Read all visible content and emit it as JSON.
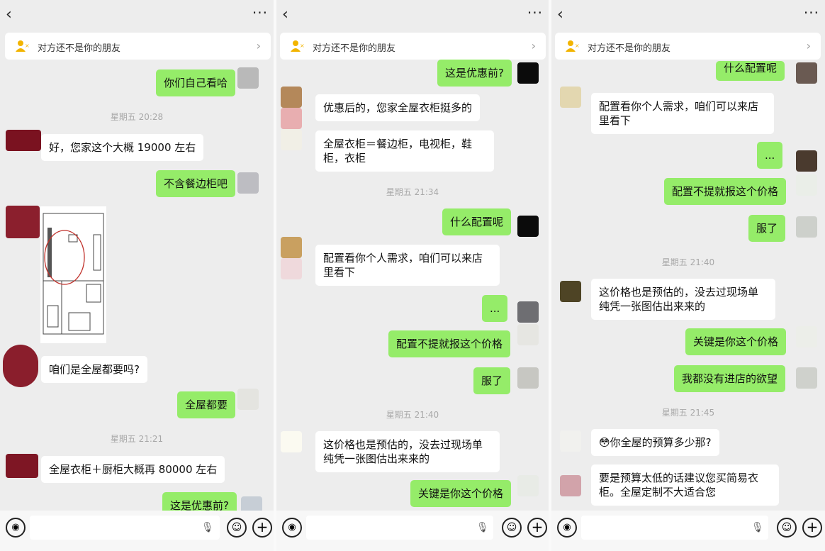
{
  "header": {
    "back_icon": "‹",
    "more_icon": "···"
  },
  "banner": {
    "text": "对方还不是你的朋友",
    "chevron": "›"
  },
  "input": {
    "voice_icon": "◉",
    "mic_icon": "🎙",
    "emoji_icon": "☺",
    "plus_icon": "+"
  },
  "panel1": {
    "m1": "你们自己看哈",
    "t1": "星期五 20:28",
    "m2": "好，您家这个大概 19000 左右",
    "m3": "不含餐边柜吧",
    "m4": "咱们是全屋都要吗?",
    "m5": "全屋都要",
    "t2": "星期五 21:21",
    "m6": "全屋衣柜＋厨柜大概再 80000 左右",
    "m7": "这是优惠前?"
  },
  "panel2": {
    "m1": "这是优惠前?",
    "m2": "优惠后的，您家全屋衣柜挺多的",
    "m3": "全屋衣柜＝餐边柜，电视柜，鞋柜，衣柜",
    "t1": "星期五 21:34",
    "m4": "什么配置呢",
    "m5": "配置看你个人需求，咱们可以来店里看下",
    "m6": "...",
    "m7": "配置不提就报这个价格",
    "m8": "服了",
    "t2": "星期五 21:40",
    "m9": "这价格也是预估的，没去过现场单纯凭一张图估出来来的",
    "m10": "关键是你这个价格"
  },
  "panel3": {
    "m1": "什么配置呢",
    "m2": "配置看你个人需求，咱们可以来店里看下",
    "m3": "...",
    "m4": "配置不提就报这个价格",
    "m5": "服了",
    "t1": "星期五 21:40",
    "m6": "这价格也是预估的，没去过现场单纯凭一张图估出来来的",
    "m7": "关键是你这个价格",
    "m8": "我都没有进店的欲望",
    "t2": "星期五 21:45",
    "m9_emoji": "😳",
    "m9": "你全屋的预算多少那?",
    "m10": "要是预算太低的话建议您买简易衣柜。全屋定制不大适合您"
  }
}
